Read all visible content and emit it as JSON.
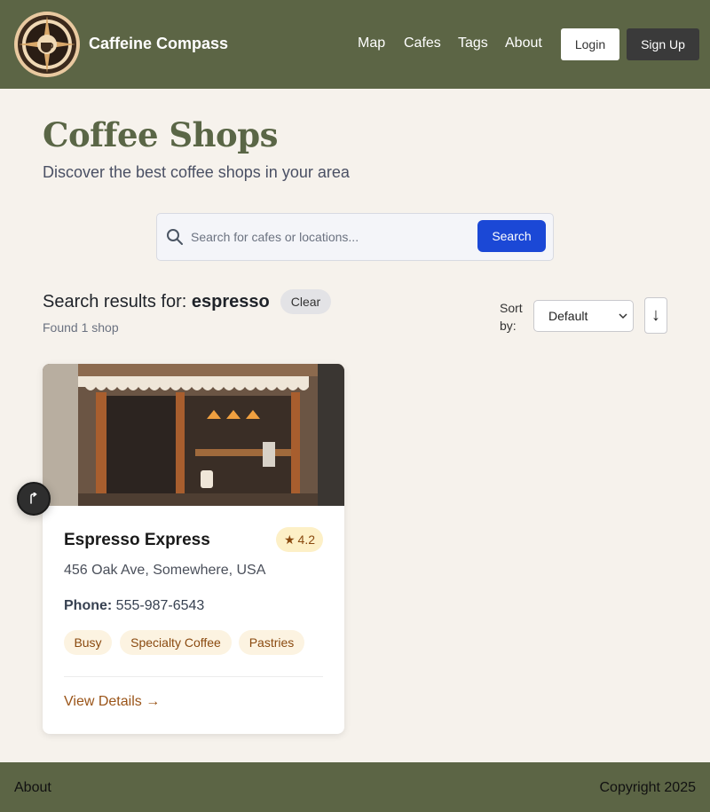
{
  "header": {
    "brand": "Caffeine Compass",
    "logo_icon": "compass-coffee-logo-icon",
    "nav": [
      "Map",
      "Cafes",
      "Tags",
      "About"
    ],
    "login_label": "Login",
    "signup_label": "Sign Up",
    "bg_color": "#5c6545"
  },
  "page": {
    "title": "Coffee Shops",
    "subtitle": "Discover the best coffee shops in your area"
  },
  "search": {
    "placeholder": "Search for cafes or locations...",
    "value": "",
    "button_label": "Search",
    "button_color": "#1b48d6"
  },
  "results": {
    "prefix": "Search results for:",
    "query": "espresso",
    "clear_label": "Clear",
    "count_text": "Found 1 shop",
    "sort_label": "Sort by:",
    "sort_value": "Default",
    "sort_direction": "↓"
  },
  "cafes": [
    {
      "name": "Espresso Express",
      "rating": "4.2",
      "address": "456 Oak Ave, Somewhere, USA",
      "phone_label": "Phone:",
      "phone": "555-987-6543",
      "tags": [
        "Busy",
        "Specialty Coffee",
        "Pastries"
      ],
      "link_label": "View Details →"
    }
  ],
  "footer": {
    "about": "About",
    "copyright": "Copyright 2025"
  }
}
